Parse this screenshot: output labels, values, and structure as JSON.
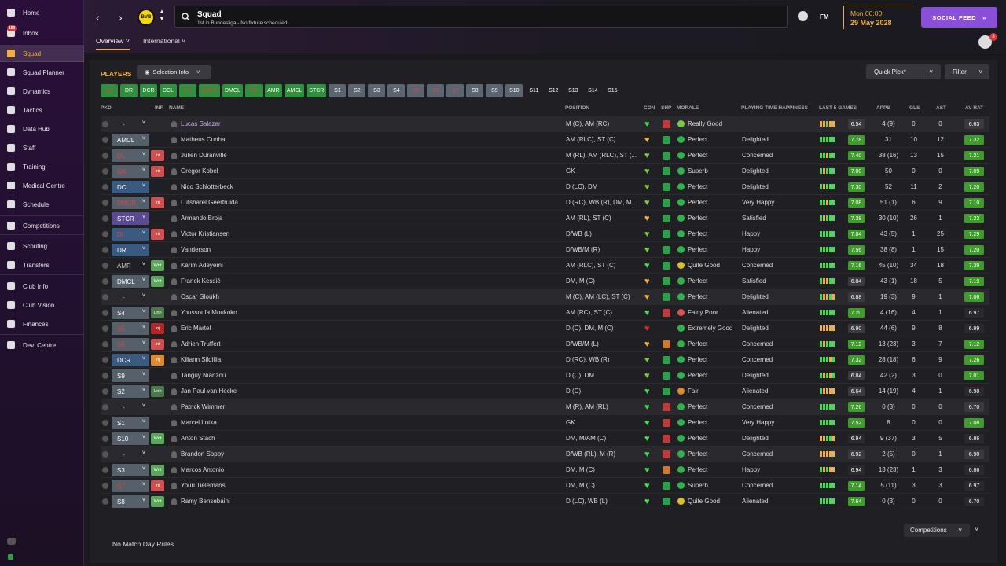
{
  "nav": {
    "items": [
      {
        "label": "Home",
        "icon": "home-icon"
      },
      {
        "label": "Inbox",
        "icon": "inbox-icon",
        "badge": "150"
      },
      {
        "label": "Squad",
        "icon": "shirt-icon",
        "active": true
      },
      {
        "label": "Squad Planner",
        "icon": "planner-icon"
      },
      {
        "label": "Dynamics",
        "icon": "dynamics-icon"
      },
      {
        "label": "Tactics",
        "icon": "tactics-icon"
      },
      {
        "label": "Data Hub",
        "icon": "data-hub-icon"
      },
      {
        "label": "Staff",
        "icon": "staff-icon"
      },
      {
        "label": "Training",
        "icon": "training-icon"
      },
      {
        "label": "Medical Centre",
        "icon": "medical-icon"
      },
      {
        "label": "Schedule",
        "icon": "calendar-icon"
      },
      {
        "label": "Competitions",
        "icon": "trophy-icon"
      },
      {
        "label": "Scouting",
        "icon": "scouting-icon"
      },
      {
        "label": "Transfers",
        "icon": "transfers-icon"
      },
      {
        "label": "Club Info",
        "icon": "shield-icon"
      },
      {
        "label": "Club Vision",
        "icon": "vision-icon"
      },
      {
        "label": "Finances",
        "icon": "finances-icon"
      },
      {
        "label": "Dev. Centre",
        "icon": "dev-centre-icon"
      }
    ]
  },
  "header": {
    "club_badge": "BVB",
    "search_title": "Squad",
    "search_sub": "1st in Bundesliga - No fixture scheduled.",
    "fm_label": "FM",
    "date_day": "Mon 00:00",
    "date_date": "29 May 2028",
    "social_feed": "SOCIAL FEED",
    "notif_badge": "8",
    "tabs": [
      "Overview",
      "International"
    ]
  },
  "toolbar": {
    "players_label": "PLAYERS",
    "selection_info": "Selection Info",
    "quick_pick": "Quick Pick*",
    "filter": "Filter"
  },
  "positions": [
    {
      "label": "GK",
      "style": "red"
    },
    {
      "label": "DR",
      "style": "green"
    },
    {
      "label": "DCR",
      "style": "green"
    },
    {
      "label": "DCL",
      "style": "green"
    },
    {
      "label": "DL",
      "style": "red"
    },
    {
      "label": "DMCR",
      "style": "red"
    },
    {
      "label": "DMCL",
      "style": "green"
    },
    {
      "label": "MC",
      "style": "red"
    },
    {
      "label": "AMR",
      "style": "green"
    },
    {
      "label": "AMCL",
      "style": "green"
    },
    {
      "label": "STCR",
      "style": "green"
    },
    {
      "label": "S1",
      "style": "grey"
    },
    {
      "label": "S2",
      "style": "grey"
    },
    {
      "label": "S3",
      "style": "grey"
    },
    {
      "label": "S4",
      "style": "grey"
    },
    {
      "label": "S5",
      "style": "greyred"
    },
    {
      "label": "S6",
      "style": "greyred"
    },
    {
      "label": "S7",
      "style": "greyred"
    },
    {
      "label": "S8",
      "style": "grey"
    },
    {
      "label": "S9",
      "style": "grey"
    },
    {
      "label": "S10",
      "style": "grey"
    },
    {
      "label": "S11",
      "style": "none"
    },
    {
      "label": "S12",
      "style": "none"
    },
    {
      "label": "S13",
      "style": "none"
    },
    {
      "label": "S14",
      "style": "none"
    },
    {
      "label": "S15",
      "style": "none"
    }
  ],
  "columns": {
    "pkd": "PKD",
    "inf": "INF",
    "name": "NAME",
    "position": "POSITION",
    "con": "CON",
    "shp": "SHP",
    "morale": "MORALE",
    "pth": "PLAYING TIME HAPPINESS",
    "last5": "LAST 5 GAMES",
    "apps": "APPS",
    "gls": "GLS",
    "ast": "AST",
    "avrat": "AV RAT"
  },
  "rows": [
    {
      "pkd": "-",
      "pkd_style": "none",
      "inf": "",
      "name": "Lucas Salazar",
      "name_color": "#c9a8e8",
      "pos": "M (C), AM (RC)",
      "con": "#3ee052",
      "shp": "red",
      "morale_icon": "#7ac943",
      "morale": "Really Good",
      "pth": "",
      "last5": [
        "#f0b040",
        "#f0b040",
        "#7ac943",
        "#f0b040",
        "#f0b040"
      ],
      "rtg": "6.54",
      "rtg_color": "#3a3a40",
      "apps": "4 (9)",
      "gls": "0",
      "ast": "0",
      "avr": "6.63",
      "avr_color": "#3a3a40",
      "ns": true
    },
    {
      "pkd": "AMCL",
      "pkd_style": "grey",
      "inf": "",
      "name": "Matheus Cunha",
      "pos": "AM (RLC), ST (C)",
      "con": "#f0b040",
      "shp": "green",
      "morale_icon": "#2fb34a",
      "morale": "Perfect",
      "pth": "Delighted",
      "last5": [
        "#3ee052",
        "#3ee052",
        "#3ee052",
        "#3ee052",
        "#3ee052"
      ],
      "rtg": "7.78",
      "rtg_color": "#3e9b2c",
      "apps": "31",
      "gls": "10",
      "ast": "12",
      "avr": "7.32",
      "avr_color": "#3e9b2c"
    },
    {
      "pkd": "DL",
      "pkd_style": "red",
      "inf": "Int",
      "inf_color": "#d05050",
      "name": "Julien Duranville",
      "pos": "M (RL), AM (RLC), ST (...",
      "con": "#7ac943",
      "shp": "green",
      "morale_icon": "#2fb34a",
      "morale": "Perfect",
      "pth": "Concerned",
      "last5": [
        "#3ee052",
        "#3ee052",
        "#f0b040",
        "#3ee052",
        "#3ee052"
      ],
      "rtg": "7.40",
      "rtg_color": "#3e9b2c",
      "apps": "38 (16)",
      "gls": "13",
      "ast": "15",
      "avr": "7.21",
      "avr_color": "#3e9b2c"
    },
    {
      "pkd": "GK",
      "pkd_style": "red",
      "inf": "Int",
      "inf_color": "#d05050",
      "name": "Gregor Kobel",
      "pos": "GK",
      "con": "#7ac943",
      "shp": "green",
      "morale_icon": "#2fb34a",
      "morale": "Superb",
      "pth": "Delighted",
      "last5": [
        "#3ee052",
        "#f0b040",
        "#3ee052",
        "#3ee052",
        "#3ee052"
      ],
      "rtg": "7.00",
      "rtg_color": "#3e9b2c",
      "apps": "50",
      "gls": "0",
      "ast": "0",
      "avr": "7.09",
      "avr_color": "#3e9b2c"
    },
    {
      "pkd": "DCL",
      "pkd_style": "blue",
      "inf": "",
      "name": "Nico Schlotterbeck",
      "pos": "D (LC), DM",
      "con": "#7ac943",
      "shp": "green",
      "morale_icon": "#2fb34a",
      "morale": "Perfect",
      "pth": "Delighted",
      "last5": [
        "#3ee052",
        "#f0b040",
        "#3ee052",
        "#3ee052",
        "#3ee052"
      ],
      "rtg": "7.30",
      "rtg_color": "#3e9b2c",
      "apps": "52",
      "gls": "11",
      "ast": "2",
      "avr": "7.20",
      "avr_color": "#3e9b2c"
    },
    {
      "pkd": "DMCR",
      "pkd_style": "red",
      "inf": "Int",
      "inf_color": "#d05050",
      "name": "Lutsharel Geertruida",
      "pos": "D (RC), WB (R), DM, M...",
      "con": "#7ac943",
      "shp": "green",
      "morale_icon": "#2fb34a",
      "morale": "Perfect",
      "pth": "Very Happy",
      "last5": [
        "#3ee052",
        "#3ee052",
        "#f0b040",
        "#3ee052",
        "#3ee052"
      ],
      "rtg": "7.08",
      "rtg_color": "#3e9b2c",
      "apps": "51 (1)",
      "gls": "6",
      "ast": "9",
      "avr": "7.10",
      "avr_color": "#3e9b2c"
    },
    {
      "pkd": "STCR",
      "pkd_style": "purple",
      "inf": "",
      "name": "Armando Broja",
      "pos": "AM (RL), ST (C)",
      "con": "#f0b040",
      "shp": "green",
      "morale_icon": "#2fb34a",
      "morale": "Perfect",
      "pth": "Satisfied",
      "last5": [
        "#3ee052",
        "#f0b040",
        "#3ee052",
        "#3ee052",
        "#3ee052"
      ],
      "rtg": "7.38",
      "rtg_color": "#3e9b2c",
      "apps": "30 (10)",
      "gls": "26",
      "ast": "1",
      "avr": "7.23",
      "avr_color": "#3e9b2c"
    },
    {
      "pkd": "DL",
      "pkd_style": "bluered",
      "inf": "Int",
      "inf_color": "#d05050",
      "name": "Victor Kristiansen",
      "pos": "D/WB (L)",
      "con": "#7ac943",
      "shp": "green",
      "morale_icon": "#2fb34a",
      "morale": "Perfect",
      "pth": "Happy",
      "last5": [
        "#3ee052",
        "#3ee052",
        "#3ee052",
        "#3ee052",
        "#3ee052"
      ],
      "rtg": "7.84",
      "rtg_color": "#3e9b2c",
      "apps": "43 (5)",
      "gls": "1",
      "ast": "25",
      "avr": "7.29",
      "avr_color": "#3e9b2c"
    },
    {
      "pkd": "DR",
      "pkd_style": "blue",
      "inf": "",
      "name": "Vanderson",
      "pos": "D/WB/M (R)",
      "con": "#7ac943",
      "shp": "green",
      "morale_icon": "#2fb34a",
      "morale": "Perfect",
      "pth": "Happy",
      "last5": [
        "#3ee052",
        "#3ee052",
        "#3ee052",
        "#3ee052",
        "#3ee052"
      ],
      "rtg": "7.56",
      "rtg_color": "#3e9b2c",
      "apps": "38 (8)",
      "gls": "1",
      "ast": "15",
      "avr": "7.20",
      "avr_color": "#3e9b2c"
    },
    {
      "pkd": "AMR",
      "pkd_style": "none2",
      "inf": "Wnt",
      "inf_color": "#5aa85a",
      "name": "Karim Adeyemi",
      "pos": "AM (RLC), ST (C)",
      "con": "#3ee052",
      "shp": "green",
      "morale_icon": "#d8c02a",
      "morale": "Quite Good",
      "pth": "Concerned",
      "last5": [
        "#3ee052",
        "#3ee052",
        "#3ee052",
        "#3ee052",
        "#3ee052"
      ],
      "rtg": "7.16",
      "rtg_color": "#3e9b2c",
      "apps": "45 (10)",
      "gls": "34",
      "ast": "18",
      "avr": "7.39",
      "avr_color": "#3e9b2c"
    },
    {
      "pkd": "DMCL",
      "pkd_style": "grey",
      "inf": "Wnt",
      "inf_color": "#5aa85a",
      "name": "Franck Kessié",
      "pos": "DM, M (C)",
      "con": "#f0b040",
      "shp": "green",
      "morale_icon": "#2fb34a",
      "morale": "Perfect",
      "pth": "Satisfied",
      "last5": [
        "#3ee052",
        "#f0b040",
        "#f0b040",
        "#3ee052",
        "#3ee052"
      ],
      "rtg": "6.84",
      "rtg_color": "#3a3a40",
      "apps": "43 (1)",
      "gls": "18",
      "ast": "5",
      "avr": "7.19",
      "avr_color": "#3e9b2c"
    },
    {
      "pkd": "-",
      "pkd_style": "none",
      "inf": "",
      "name": "Oscar Gloukh",
      "pos": "M (C), AM (LC), ST (C)",
      "con": "#f0b040",
      "shp": "green",
      "morale_icon": "#2fb34a",
      "morale": "Perfect",
      "pth": "Delighted",
      "last5": [
        "#3ee052",
        "#f0b040",
        "#f0b040",
        "#3ee052",
        "#f0b040"
      ],
      "rtg": "6.88",
      "rtg_color": "#3a3a40",
      "apps": "19 (3)",
      "gls": "9",
      "ast": "1",
      "avr": "7.06",
      "avr_color": "#3e9b2c",
      "ns": true
    },
    {
      "pkd": "S4",
      "pkd_style": "grey",
      "inf": "Unh",
      "inf_color": "#4a7a4a",
      "name": "Youssoufa Moukoko",
      "pos": "AM (RC), ST (C)",
      "con": "#3ee052",
      "shp": "red",
      "morale_icon": "#e05050",
      "morale": "Fairly Poor",
      "pth": "Alienated",
      "last5": [
        "#3ee052",
        "#3ee052",
        "#3ee052",
        "#3ee052",
        "#3ee052"
      ],
      "rtg": "7.20",
      "rtg_color": "#3e9b2c",
      "apps": "4 (16)",
      "gls": "4",
      "ast": "1",
      "avr": "6.97",
      "avr_color": "#2a2a2e"
    },
    {
      "pkd": "S5",
      "pkd_style": "greyred",
      "inf": "Inj",
      "inf_color": "#b02828",
      "name": "Eric Martel",
      "pos": "D (C), DM, M (C)",
      "con": "#d03030",
      "shp": "none",
      "morale_icon": "#2fb34a",
      "morale": "Extremely Good",
      "pth": "Delighted",
      "last5": [
        "#f0b040",
        "#f0b040",
        "#f0b040",
        "#f0b040",
        "#f0b040"
      ],
      "rtg": "6.90",
      "rtg_color": "#3a3a40",
      "apps": "44 (6)",
      "gls": "9",
      "ast": "8",
      "avr": "6.99",
      "avr_color": "#2a2a2e"
    },
    {
      "pkd": "S6",
      "pkd_style": "greyred",
      "inf": "Int",
      "inf_color": "#d05050",
      "name": "Adrien Truffert",
      "pos": "D/WB/M (L)",
      "con": "#f0b040",
      "shp": "orange",
      "morale_icon": "#2fb34a",
      "morale": "Perfect",
      "pth": "Concerned",
      "last5": [
        "#3ee052",
        "#f0b040",
        "#3ee052",
        "#3ee052",
        "#3ee052"
      ],
      "rtg": "7.12",
      "rtg_color": "#3e9b2c",
      "apps": "13 (23)",
      "gls": "3",
      "ast": "7",
      "avr": "7.12",
      "avr_color": "#3e9b2c"
    },
    {
      "pkd": "DCR",
      "pkd_style": "blue",
      "inf": "Inj",
      "inf_color": "#e08a30",
      "name": "Kiliann Sildillia",
      "pos": "D (RC), WB (R)",
      "con": "#7ac943",
      "shp": "green",
      "morale_icon": "#2fb34a",
      "morale": "Perfect",
      "pth": "Concerned",
      "last5": [
        "#3ee052",
        "#3ee052",
        "#3ee052",
        "#f0b040",
        "#3ee052"
      ],
      "rtg": "7.32",
      "rtg_color": "#3e9b2c",
      "apps": "28 (18)",
      "gls": "6",
      "ast": "9",
      "avr": "7.26",
      "avr_color": "#3e9b2c"
    },
    {
      "pkd": "S9",
      "pkd_style": "grey",
      "inf": "",
      "name": "Tanguy Nianzou",
      "pos": "D (C), DM",
      "con": "#7ac943",
      "shp": "green",
      "morale_icon": "#2fb34a",
      "morale": "Perfect",
      "pth": "Delighted",
      "last5": [
        "#3ee052",
        "#f0b040",
        "#3ee052",
        "#f0b040",
        "#3ee052"
      ],
      "rtg": "6.84",
      "rtg_color": "#3a3a40",
      "apps": "42 (2)",
      "gls": "3",
      "ast": "0",
      "avr": "7.01",
      "avr_color": "#3e9b2c"
    },
    {
      "pkd": "S2",
      "pkd_style": "grey",
      "inf": "Unh",
      "inf_color": "#4a7a4a",
      "name": "Jan Paul van Hecke",
      "pos": "D (C)",
      "con": "#3ee052",
      "shp": "green",
      "morale_icon": "#e08a30",
      "morale": "Fair",
      "pth": "Alienated",
      "last5": [
        "#3ee052",
        "#f0b040",
        "#f0b040",
        "#f0b040",
        "#f0b040"
      ],
      "rtg": "6.64",
      "rtg_color": "#3a3a40",
      "apps": "14 (19)",
      "gls": "4",
      "ast": "1",
      "avr": "6.98",
      "avr_color": "#2a2a2e"
    },
    {
      "pkd": "-",
      "pkd_style": "none",
      "inf": "",
      "name": "Patrick Wimmer",
      "pos": "M (R), AM (RL)",
      "con": "#3ee052",
      "shp": "red",
      "morale_icon": "#2fb34a",
      "morale": "Perfect",
      "pth": "Concerned",
      "last5": [
        "#3ee052",
        "#3ee052",
        "#3ee052",
        "#3ee052",
        "#3ee052"
      ],
      "rtg": "7.26",
      "rtg_color": "#3e9b2c",
      "apps": "0 (3)",
      "gls": "0",
      "ast": "0",
      "avr": "6.70",
      "avr_color": "#3a3a40",
      "ns": true
    },
    {
      "pkd": "S1",
      "pkd_style": "grey",
      "inf": "",
      "name": "Marcel Lotka",
      "pos": "GK",
      "con": "#3ee052",
      "shp": "red",
      "morale_icon": "#2fb34a",
      "morale": "Perfect",
      "pth": "Very Happy",
      "last5": [
        "#3ee052",
        "#3ee052",
        "#3ee052",
        "#3ee052",
        "#3ee052"
      ],
      "rtg": "7.52",
      "rtg_color": "#3e9b2c",
      "apps": "8",
      "gls": "0",
      "ast": "0",
      "avr": "7.08",
      "avr_color": "#3e9b2c"
    },
    {
      "pkd": "S10",
      "pkd_style": "grey",
      "inf": "Wnt",
      "inf_color": "#5aa85a",
      "name": "Anton Stach",
      "pos": "DM, M/AM (C)",
      "con": "#3ee052",
      "shp": "red",
      "morale_icon": "#2fb34a",
      "morale": "Perfect",
      "pth": "Delighted",
      "last5": [
        "#f0b040",
        "#f0b040",
        "#3ee052",
        "#3ee052",
        "#f0b040"
      ],
      "rtg": "6.94",
      "rtg_color": "#2a2a2e",
      "apps": "9 (37)",
      "gls": "3",
      "ast": "5",
      "avr": "6.86",
      "avr_color": "#2a2a2e"
    },
    {
      "pkd": "-",
      "pkd_style": "none",
      "inf": "",
      "name": "Brandon Soppy",
      "pos": "D/WB (RL), M (R)",
      "con": "#3ee052",
      "shp": "red",
      "morale_icon": "#2fb34a",
      "morale": "Perfect",
      "pth": "Concerned",
      "last5": [
        "#f0b040",
        "#f0b040",
        "#f0b040",
        "#f0b040",
        "#f0b040"
      ],
      "rtg": "6.92",
      "rtg_color": "#3a3a40",
      "apps": "2 (5)",
      "gls": "0",
      "ast": "1",
      "avr": "6.90",
      "avr_color": "#3a3a40",
      "ns": true
    },
    {
      "pkd": "S3",
      "pkd_style": "grey",
      "inf": "Wnt",
      "inf_color": "#5aa85a",
      "name": "Marcos Antonio",
      "pos": "DM, M (C)",
      "con": "#3ee052",
      "shp": "orange",
      "morale_icon": "#2fb34a",
      "morale": "Perfect",
      "pth": "Happy",
      "last5": [
        "#3ee052",
        "#f0b040",
        "#3ee052",
        "#f0b040",
        "#f0b040"
      ],
      "rtg": "6.94",
      "rtg_color": "#2a2a2e",
      "apps": "13 (23)",
      "gls": "1",
      "ast": "3",
      "avr": "6.86",
      "avr_color": "#2a2a2e"
    },
    {
      "pkd": "S7",
      "pkd_style": "greyred",
      "inf": "Int",
      "inf_color": "#d05050",
      "name": "Youri Tielemans",
      "pos": "DM, M (C)",
      "con": "#3ee052",
      "shp": "green",
      "morale_icon": "#2fb34a",
      "morale": "Superb",
      "pth": "Concerned",
      "last5": [
        "#3ee052",
        "#3ee052",
        "#3ee052",
        "#3ee052",
        "#3ee052"
      ],
      "rtg": "7.14",
      "rtg_color": "#3e9b2c",
      "apps": "5 (11)",
      "gls": "3",
      "ast": "3",
      "avr": "6.97",
      "avr_color": "#2a2a2e"
    },
    {
      "pkd": "S8",
      "pkd_style": "grey",
      "inf": "Wnt",
      "inf_color": "#5aa85a",
      "name": "Ramy Bensebaini",
      "pos": "D (LC), WB (L)",
      "con": "#3ee052",
      "shp": "green",
      "morale_icon": "#d8c02a",
      "morale": "Quite Good",
      "pth": "Alienated",
      "last5": [
        "#3ee052",
        "#3ee052",
        "#3ee052",
        "#3ee052",
        "#3ee052"
      ],
      "rtg": "7.64",
      "rtg_color": "#3e9b2c",
      "apps": "0 (3)",
      "gls": "0",
      "ast": "0",
      "avr": "6.70",
      "avr_color": "#2a2a2e"
    }
  ],
  "footer": {
    "competitions": "Competitions",
    "no_match": "No Match Day Rules"
  }
}
